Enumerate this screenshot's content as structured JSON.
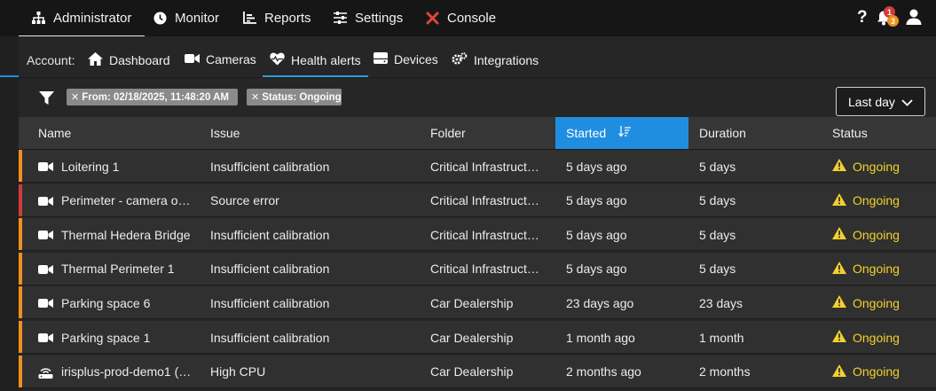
{
  "topnav": {
    "items": [
      {
        "label": "Administrator",
        "icon": "sitemap-icon",
        "active": true
      },
      {
        "label": "Monitor",
        "icon": "clock-icon"
      },
      {
        "label": "Reports",
        "icon": "chart-icon"
      },
      {
        "label": "Settings",
        "icon": "sliders-icon"
      },
      {
        "label": "Console",
        "icon": "tools-icon"
      }
    ],
    "help": "?",
    "notifications": {
      "count_red": "1",
      "count_orange": "3"
    }
  },
  "subnav": {
    "account_label": "Account:",
    "items": [
      {
        "label": "Dashboard",
        "icon": "home-icon"
      },
      {
        "label": "Cameras",
        "icon": "video-camera-icon"
      },
      {
        "label": "Health alerts",
        "icon": "heart-pulse-icon",
        "active": true
      },
      {
        "label": "Devices",
        "icon": "server-icon"
      },
      {
        "label": "Integrations",
        "icon": "cogs-icon"
      }
    ]
  },
  "filters": {
    "chips": [
      {
        "label": "From: 02/18/2025, 11:48:20 AM",
        "remove": "✕"
      },
      {
        "label": "Status: Ongoing",
        "remove": "✕"
      }
    ],
    "range": "Last day"
  },
  "table": {
    "columns": [
      "Name",
      "Issue",
      "Folder",
      "Started",
      "Duration",
      "Status"
    ],
    "sorted_column": "Started",
    "rows": [
      {
        "name": "Loitering 1",
        "issue": "Insufficient calibration",
        "folder": "Critical Infrastruct…",
        "started": "5 days ago",
        "duration": "5 days",
        "status": "Ongoing",
        "severity_color": "#f0901e",
        "icon": "video-camera-icon"
      },
      {
        "name": "Perimeter - camera o…",
        "issue": "Source error",
        "folder": "Critical Infrastruct…",
        "started": "5 days ago",
        "duration": "5 days",
        "status": "Ongoing",
        "severity_color": "#d23b3b",
        "icon": "video-camera-icon"
      },
      {
        "name": "Thermal Hedera Bridge",
        "issue": "Insufficient calibration",
        "folder": "Critical Infrastruct…",
        "started": "5 days ago",
        "duration": "5 days",
        "status": "Ongoing",
        "severity_color": "#f0901e",
        "icon": "video-camera-icon"
      },
      {
        "name": "Thermal Perimeter 1",
        "issue": "Insufficient calibration",
        "folder": "Critical Infrastruct…",
        "started": "5 days ago",
        "duration": "5 days",
        "status": "Ongoing",
        "severity_color": "#f0901e",
        "icon": "video-camera-icon"
      },
      {
        "name": "Parking space 6",
        "issue": "Insufficient calibration",
        "folder": "Car Dealership",
        "started": "23 days ago",
        "duration": "23 days",
        "status": "Ongoing",
        "severity_color": "#f0901e",
        "icon": "video-camera-icon"
      },
      {
        "name": "Parking space 1",
        "issue": "Insufficient calibration",
        "folder": "Car Dealership",
        "started": "1 month ago",
        "duration": "1 month",
        "status": "Ongoing",
        "severity_color": "#f0901e",
        "icon": "video-camera-icon"
      },
      {
        "name": "irisplus-prod-demo1 (…",
        "issue": "High CPU",
        "folder": "Car Dealership",
        "started": "2 months ago",
        "duration": "2 months",
        "status": "Ongoing",
        "severity_color": "#f0901e",
        "icon": "router-icon"
      }
    ]
  },
  "colors": {
    "accent": "#1f8ee0",
    "warning": "#f3d12c",
    "severity_orange": "#f0901e",
    "severity_red": "#d23b3b"
  }
}
